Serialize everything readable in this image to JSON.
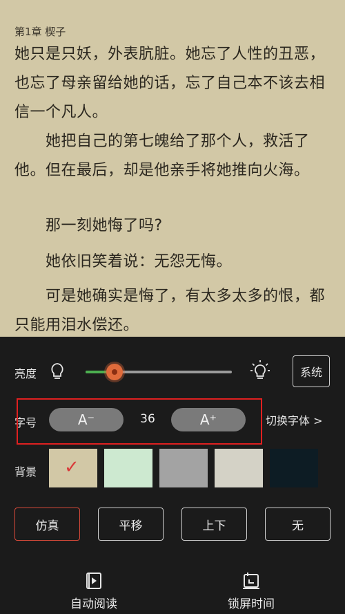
{
  "reader": {
    "chapter_title": "第1章 楔子",
    "paragraphs": [
      "她只是只妖，外表肮脏。她忘了人性的丑恶，也忘了母亲留给她的话，忘了自己本不该去相信一个凡人。",
      "　　她把自己的第七魄给了那个人，救活了他。但在最后，却是他亲手将她推向火海。",
      "　　那一刻她悔了吗?",
      "　　她依旧笑着说：无怨无悔。",
      "　　可是她确实是悔了，有太多太多的恨，都只能用泪水偿还。"
    ]
  },
  "settings": {
    "brightness": {
      "label": "亮度",
      "level_fraction": 0.2,
      "system_label": "系统",
      "icon_low": "lightbulb-icon",
      "icon_high": "lightbulb-bright-icon"
    },
    "font_size": {
      "label": "字号",
      "decrease_label": "A⁻",
      "increase_label": "A⁺",
      "value": "36",
      "switch_font_label": "切换字体 >"
    },
    "background": {
      "label": "背景",
      "colors": [
        "#d2c8a6",
        "#cde9d0",
        "#a3a3a3",
        "#d4d2c6",
        "#0d1c24"
      ],
      "selected_index": 0
    },
    "page_turn": {
      "modes": [
        "仿真",
        "平移",
        "上下",
        "无"
      ],
      "selected_index": 0
    },
    "bottom_actions": [
      {
        "label": "自动阅读",
        "icon": "play-book-icon"
      },
      {
        "label": "锁屏时间",
        "icon": "lock-timer-icon"
      }
    ]
  },
  "colors": {
    "accent_red": "#e02020",
    "slider_green": "#4caf50",
    "knob_orange": "#e06b3b"
  }
}
